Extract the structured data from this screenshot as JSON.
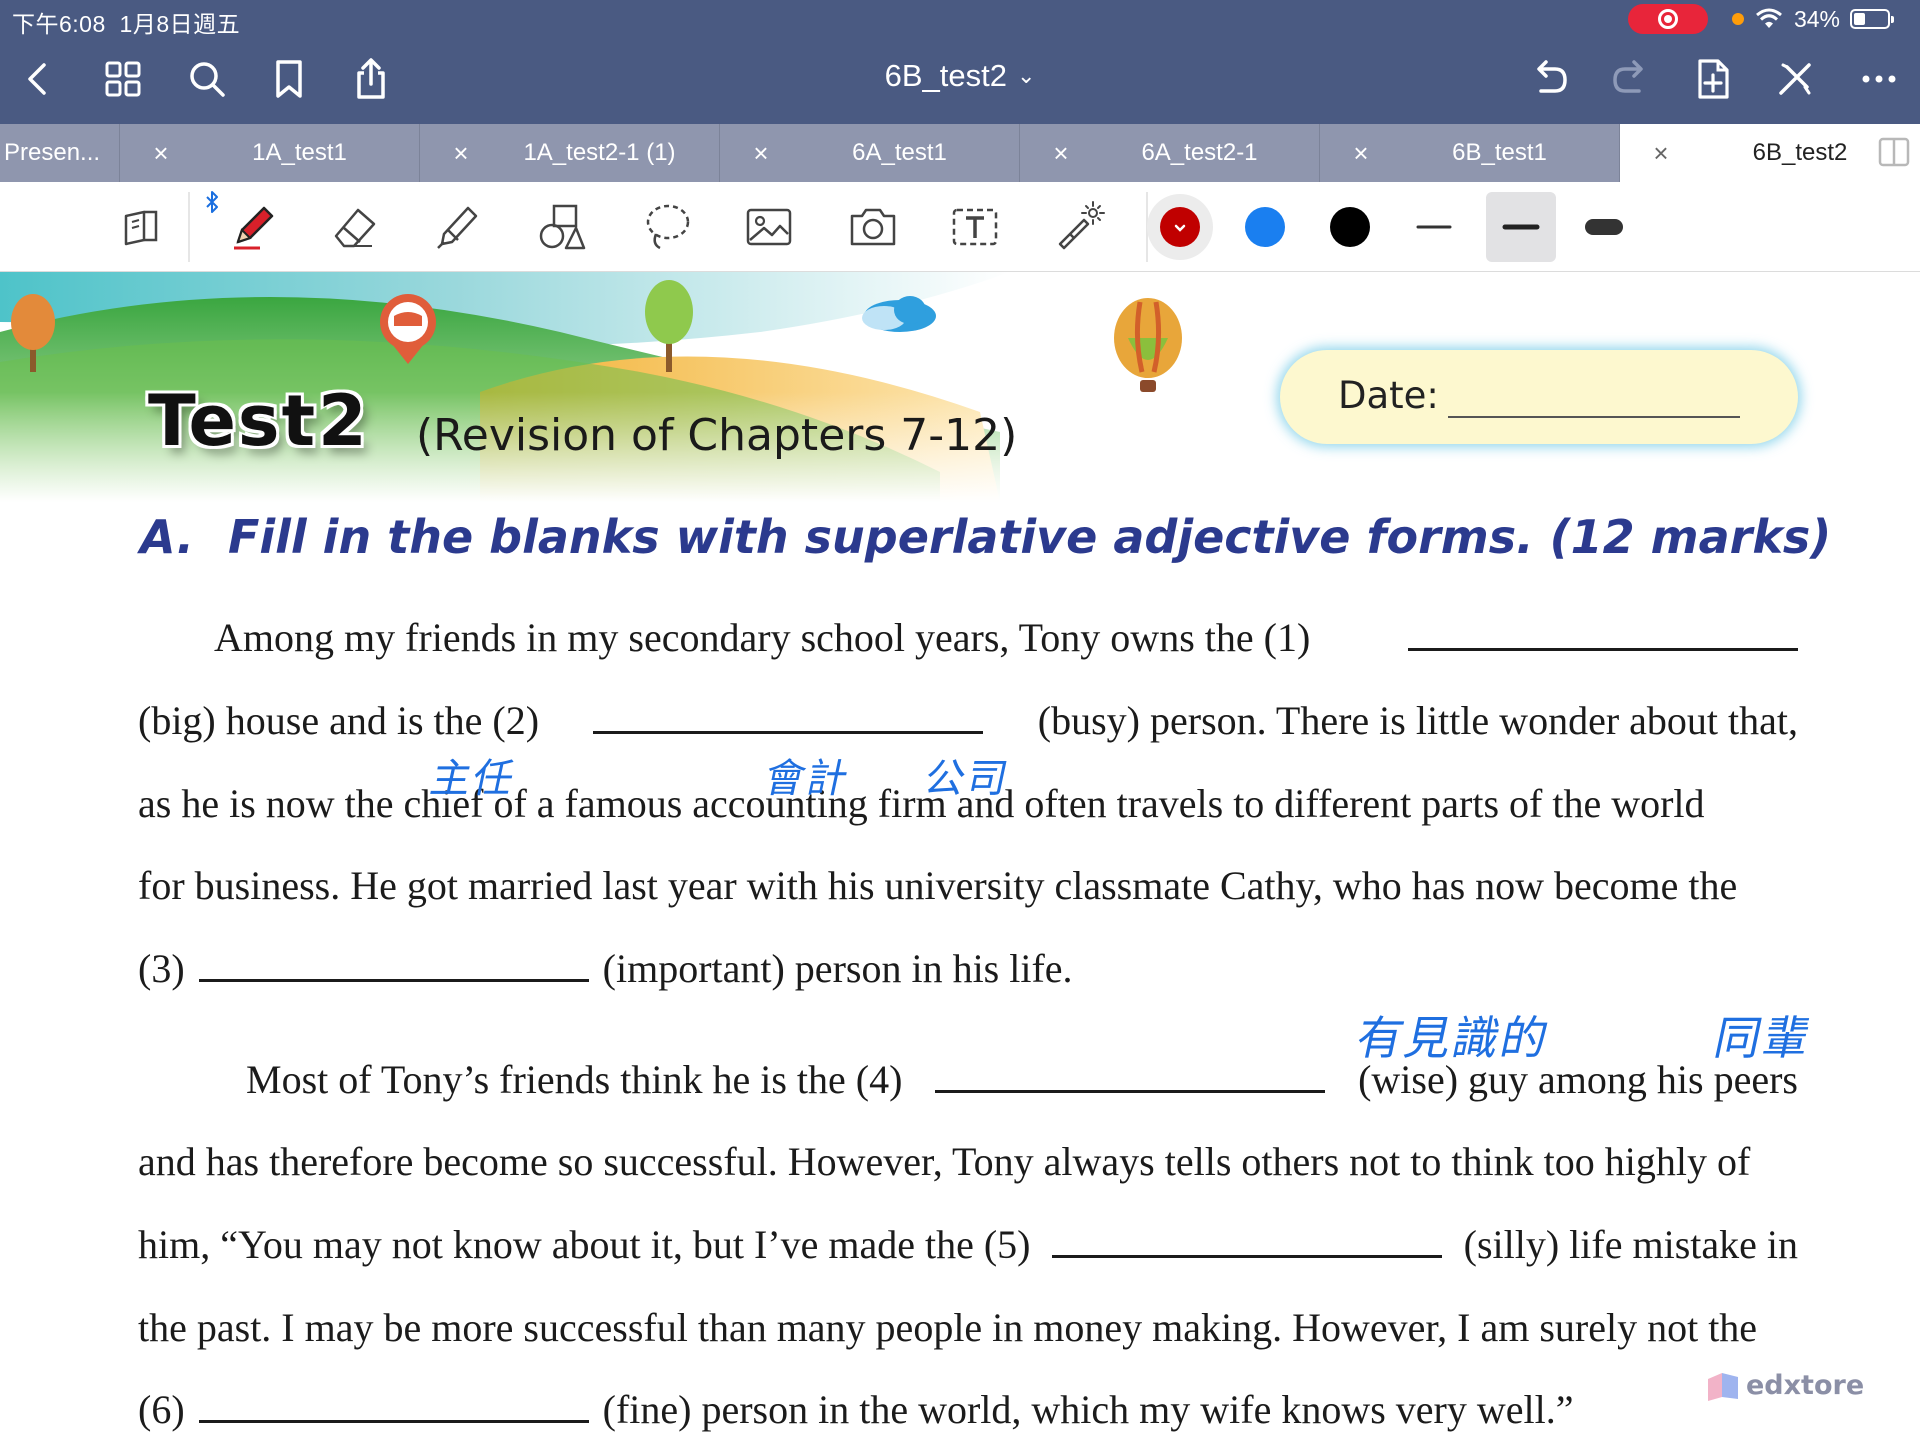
{
  "status_bar": {
    "time": "下午6:08",
    "date": "1月8日週五",
    "battery_text": "34%",
    "battery_level": 0.34
  },
  "title_bar": {
    "document_title": "6B_test2",
    "chevron": "⌄"
  },
  "nav_icons": [
    "back-chevron-icon",
    "grid-icon",
    "search-icon",
    "bookmark-icon",
    "share-icon",
    "undo-icon",
    "redo-icon",
    "add-page-icon",
    "close-toolbar-icon",
    "more-icon"
  ],
  "tabs": [
    {
      "label": "Presen...",
      "active": false
    },
    {
      "label": "1A_test1",
      "active": false
    },
    {
      "label": "1A_test2-1 (1)",
      "active": false
    },
    {
      "label": "6A_test1",
      "active": false
    },
    {
      "label": "6A_test2-1",
      "active": false
    },
    {
      "label": "6B_test1",
      "active": false
    },
    {
      "label": "6B_test2",
      "active": true
    }
  ],
  "tab_close_glyph": "×",
  "toolbar": {
    "tools": [
      "read-mode-icon",
      "pen-icon",
      "eraser-icon",
      "highlighter-icon",
      "shapes-icon",
      "lasso-icon",
      "image-icon",
      "camera-icon",
      "text-box-icon",
      "laser-pointer-icon"
    ],
    "selected_tool": "pen-icon",
    "colors": [
      "#c00000",
      "#1a7ff0",
      "#000000"
    ],
    "selected_color": "#c00000",
    "stroke_widths": [
      "thin",
      "medium",
      "thick"
    ],
    "selected_stroke": "medium"
  },
  "document": {
    "test_title": "Test",
    "test_number": "2",
    "subtitle": "(Revision of Chapters 7-12)",
    "date_label": "Date:",
    "section_label": "A.",
    "section_instruction": "Fill in the blanks with superlative adjective forms. (12 marks)",
    "lines": [
      {
        "before": "Among my friends in my secondary school years, Tony owns the (1)",
        "after": ""
      },
      {
        "before": "(big) house and is the (2)",
        "after": "(busy) person. There is little wonder about that,"
      },
      {
        "text": "as he is now the chief of a famous accounting firm and often travels to different parts of the world"
      },
      {
        "text": "for business. He got married last year with his university classmate Cathy, who has now become the"
      },
      {
        "before": "(3)",
        "after": "(important) person in his life."
      },
      {
        "before": "Most of Tony’s friends think he is the (4)",
        "after": "(wise) guy among his peers"
      },
      {
        "text": "and has therefore become so successful. However, Tony always tells others not to think too highly of"
      },
      {
        "before": "him, “You may not know about it, but I’ve made the (5)",
        "after": "(silly) life mistake in"
      },
      {
        "text": "the past. I may be more successful than many people in money making. However, I am surely not the"
      },
      {
        "before": "(6)",
        "after": "(fine) person in the world, which my wife knows very well.”"
      }
    ],
    "handwritten_notes": [
      "主任",
      "會計",
      "公司",
      "有見識的",
      "同輩"
    ],
    "watermark": "edxtore",
    "handwriting_color": "#1f6fe0",
    "heading_color": "#2b3a8e"
  }
}
